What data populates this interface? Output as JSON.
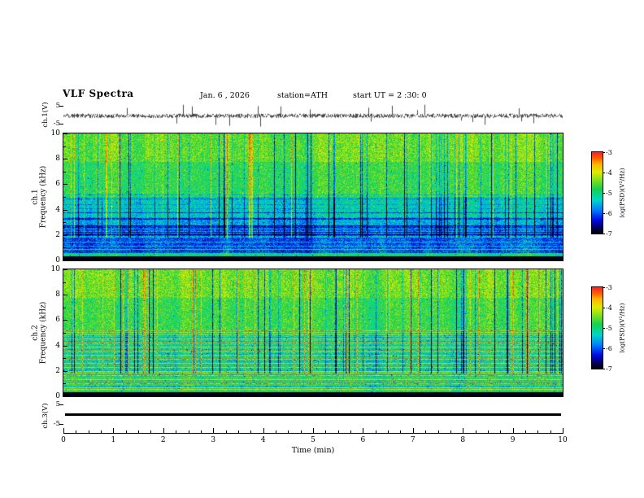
{
  "header": {
    "title": "VLF Spectra",
    "date": "Jan. 6 , 2026",
    "station": "station=ATH",
    "start_ut": "start UT =  2 :30: 0"
  },
  "xaxis": {
    "label": "Time (min)",
    "ticks": [
      "0",
      "1",
      "2",
      "3",
      "4",
      "5",
      "6",
      "7",
      "8",
      "9",
      "10"
    ],
    "range": [
      0,
      10
    ]
  },
  "panels": {
    "wave1": {
      "ylabel": "ch.1(V)",
      "yticks": [
        "5",
        "-5"
      ],
      "range": [
        -5,
        5
      ]
    },
    "spec1": {
      "ylabel_ch": "ch.1",
      "ylabel_axis": "Frequency (kHz)",
      "yticks": [
        "10",
        "8",
        "6",
        "4",
        "2",
        "0"
      ],
      "range": [
        0,
        10
      ]
    },
    "spec2": {
      "ylabel_ch": "ch.2",
      "ylabel_axis": "Frequency (kHz)",
      "yticks": [
        "10",
        "8",
        "6",
        "4",
        "2",
        "0"
      ],
      "range": [
        0,
        10
      ]
    },
    "wave3": {
      "ylabel": "ch.3(V)",
      "yticks": [
        "5",
        "-5"
      ],
      "range": [
        -5,
        5
      ]
    }
  },
  "colorbar": {
    "label": "log(PSD)(V²/Hz)",
    "ticks": [
      "-3",
      "-4",
      "-5",
      "-6",
      "-7"
    ],
    "range": [
      -7,
      -3
    ]
  },
  "chart_data": [
    {
      "type": "line",
      "name": "ch.1 waveform",
      "xlabel": "Time (min)",
      "ylabel": "ch.1(V)",
      "xlim": [
        0,
        10
      ],
      "ylim": [
        -5,
        5
      ],
      "summary": "dense broadband noise centered on 0 V with frequent impulsive spikes reaching about ±5 V across the whole 10 minutes"
    },
    {
      "type": "heatmap",
      "name": "ch.1 spectrogram",
      "xlabel": "Time (min)",
      "ylabel": "Frequency (kHz)",
      "xlim": [
        0,
        10
      ],
      "ylim": [
        0,
        10
      ],
      "zlabel": "log(PSD)(V²/Hz)",
      "zlim": [
        -7,
        -3
      ],
      "summary": "green/yellow broadband power above ~5 kHz, blue band 2–5 kHz crossed by dense dark-blue vertical sferic streaks, dark blue 0.5–2 kHz with speckle, near-black band below ~0.4 kHz",
      "colormap": "jet-like: black(-7) → blue → cyan → green → yellow → red(-3)",
      "render_seed": 1337
    },
    {
      "type": "heatmap",
      "name": "ch.2 spectrogram",
      "xlabel": "Time (min)",
      "ylabel": "Frequency (kHz)",
      "xlim": [
        0,
        10
      ],
      "ylim": [
        0,
        10
      ],
      "zlabel": "log(PSD)(V²/Hz)",
      "zlim": [
        -7,
        -3
      ],
      "summary": "similar green broadband power above ~5 kHz with vertical streaks; below ~5 kHz strong horizontal harmonic lines (yellow/orange over cyan-green), near-black band at the bottom",
      "colormap": "jet-like: black(-7) → blue → cyan → green → yellow → red(-3)",
      "render_seed": 9021
    },
    {
      "type": "line",
      "name": "ch.3 waveform",
      "xlabel": "Time (min)",
      "ylabel": "ch.3(V)",
      "xlim": [
        0,
        10
      ],
      "ylim": [
        -5,
        5
      ],
      "summary": "constant flat trace slightly below 0 V (≈ -0.5 V) for the entire record"
    }
  ]
}
